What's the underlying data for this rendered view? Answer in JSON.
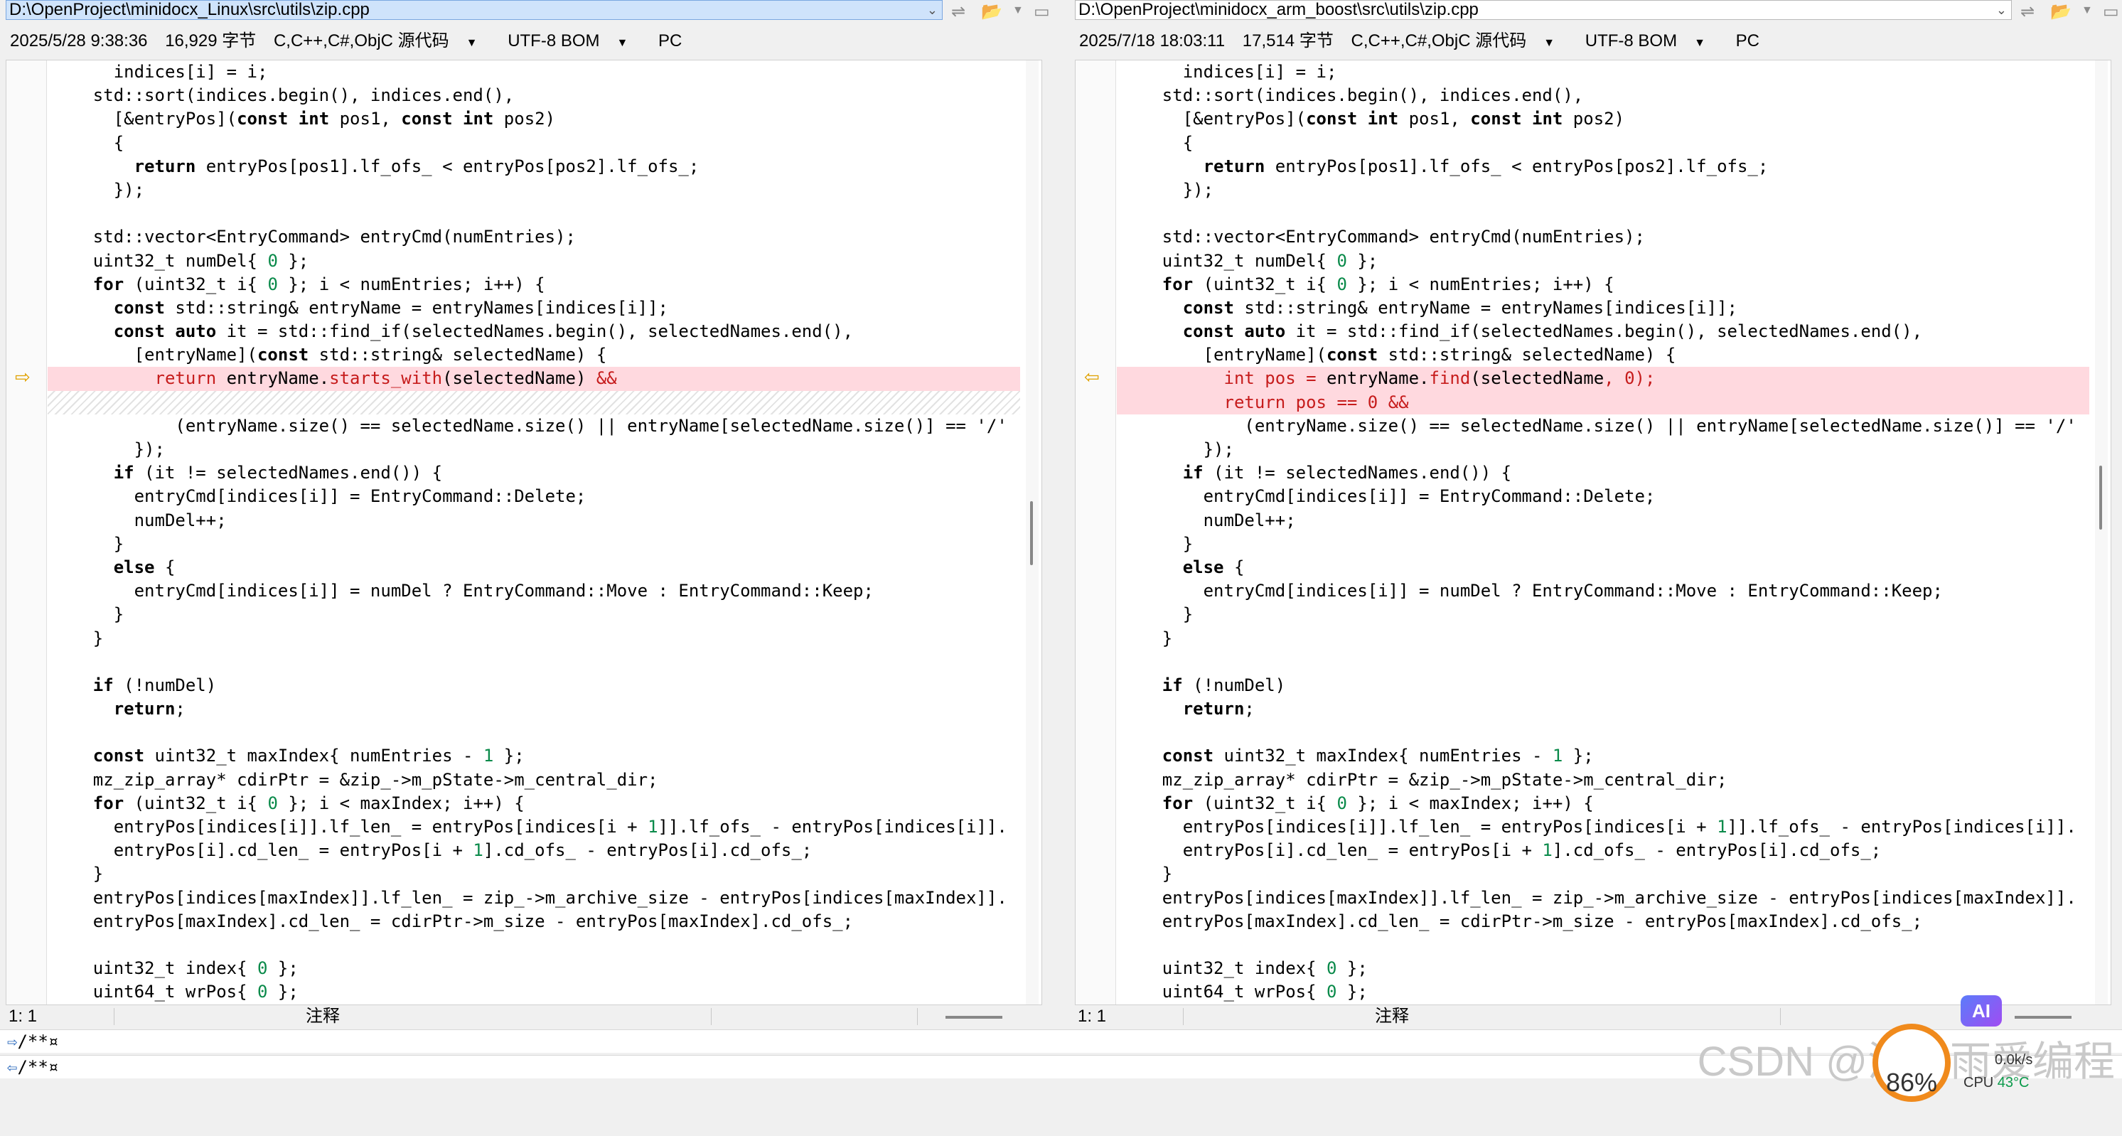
{
  "left": {
    "path": "D:\\OpenProject\\minidocx_Linux\\src\\utils\\zip.cpp",
    "timestamp": "2025/5/28 9:38:36",
    "size": "16,929 字节",
    "language": "C,C++,C#,ObjC 源代码",
    "encoding": "UTF-8 BOM",
    "lineend": "PC",
    "status_pos": "1: 1",
    "status_section": "注释"
  },
  "right": {
    "path": "D:\\OpenProject\\minidocx_arm_boost\\src\\utils\\zip.cpp",
    "timestamp": "2025/7/18 18:03:11",
    "size": "17,514 字节",
    "language": "C,C++,C#,ObjC 源代码",
    "encoding": "UTF-8 BOM",
    "lineend": "PC",
    "status_pos": "1: 1",
    "status_section": "注释"
  },
  "icons": {
    "copy": "copy-icon",
    "folder": "folder-icon",
    "save": "save-icon",
    "diff_arrow_left": "arrow-right-icon",
    "diff_arrow_right": "arrow-left-icon"
  },
  "bottom": {
    "line1": "/**¤",
    "line2": "/**¤"
  },
  "overlay": {
    "watermark": "CSDN @流星雨爱编程",
    "ai": "AI",
    "gauge": "86%",
    "net": "0.0k/s",
    "cpu_label": "CPU",
    "cpu_value": "43°C"
  },
  "colors": {
    "changed_bg": "#ffd9df",
    "changed_fg": "#c61c1c",
    "number": "#0a8a4a",
    "path_highlight": "#cfe3fb"
  }
}
